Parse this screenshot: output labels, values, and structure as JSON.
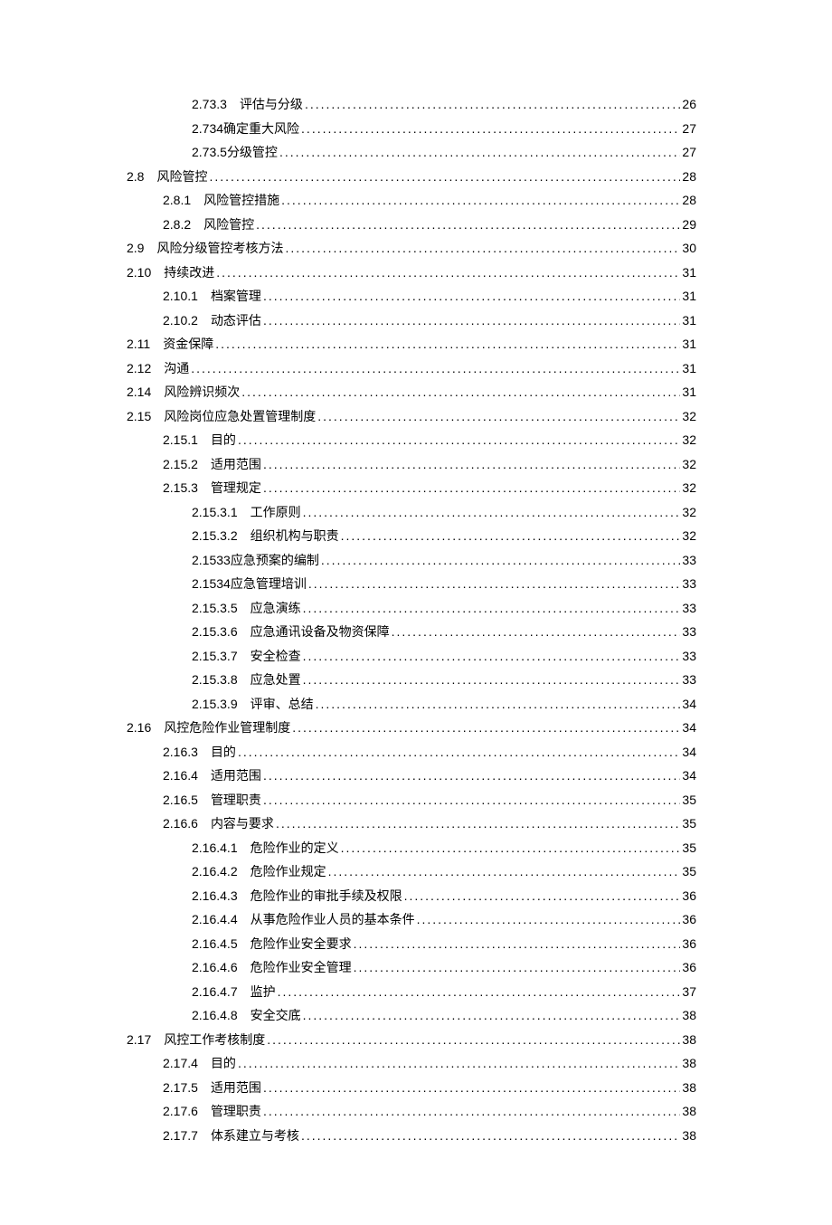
{
  "toc": [
    {
      "indent": 2,
      "num": "2.73.3",
      "title": "评估与分级",
      "page": "26"
    },
    {
      "indent": 2,
      "num": "2.734",
      "title": "确定重大风险",
      "page": "27",
      "nogap": true
    },
    {
      "indent": 2,
      "num": "2.73.5",
      "title": "分级管控",
      "page": "27",
      "nogap": true
    },
    {
      "indent": 0,
      "num": "2.8",
      "title": "风险管控",
      "page": "28"
    },
    {
      "indent": 1,
      "num": "2.8.1",
      "title": "风险管控措施",
      "page": "28"
    },
    {
      "indent": 1,
      "num": "2.8.2",
      "title": "风险管控",
      "page": "29"
    },
    {
      "indent": 0,
      "num": "2.9",
      "title": "风险分级管控考核方法",
      "page": "30"
    },
    {
      "indent": 0,
      "num": "2.10",
      "title": "持续改进",
      "page": "31"
    },
    {
      "indent": 1,
      "num": "2.10.1",
      "title": "档案管理",
      "page": "31"
    },
    {
      "indent": 1,
      "num": "2.10.2",
      "title": "动态评估",
      "page": "31"
    },
    {
      "indent": 0,
      "num": "2.11",
      "title": "资金保障",
      "page": "31"
    },
    {
      "indent": 0,
      "num": "2.12",
      "title": "沟通",
      "page": "31"
    },
    {
      "indent": 0,
      "num": "2.14",
      "title": "风险辨识频次",
      "page": "31"
    },
    {
      "indent": 0,
      "num": "2.15",
      "title": "风险岗位应急处置管理制度",
      "page": "32"
    },
    {
      "indent": 1,
      "num": "2.15.1",
      "title": "目的",
      "page": "32"
    },
    {
      "indent": 1,
      "num": "2.15.2",
      "title": "适用范围",
      "page": "32"
    },
    {
      "indent": 1,
      "num": "2.15.3",
      "title": "管理规定",
      "page": "32"
    },
    {
      "indent": 2,
      "num": "2.15.3.1",
      "title": "工作原则",
      "page": "32"
    },
    {
      "indent": 2,
      "num": "2.15.3.2",
      "title": "组织机构与职责",
      "page": "32"
    },
    {
      "indent": 2,
      "num": "2.1533",
      "title": "应急预案的编制",
      "page": "33",
      "nogap": true
    },
    {
      "indent": 2,
      "num": "2.1534",
      "title": "应急管理培训",
      "page": "33",
      "nogap": true
    },
    {
      "indent": 2,
      "num": "2.15.3.5",
      "title": "应急演练",
      "page": "33"
    },
    {
      "indent": 2,
      "num": "2.15.3.6",
      "title": "应急通讯设备及物资保障",
      "page": "33"
    },
    {
      "indent": 2,
      "num": "2.15.3.7",
      "title": "安全检查",
      "page": "33"
    },
    {
      "indent": 2,
      "num": "2.15.3.8",
      "title": "应急处置",
      "page": "33"
    },
    {
      "indent": 2,
      "num": "2.15.3.9",
      "title": "评审、总结",
      "page": "34"
    },
    {
      "indent": 0,
      "num": "2.16",
      "title": "风控危险作业管理制度",
      "page": "34"
    },
    {
      "indent": 1,
      "num": "2.16.3",
      "title": "目的",
      "page": "34"
    },
    {
      "indent": 1,
      "num": "2.16.4",
      "title": "适用范围",
      "page": "34"
    },
    {
      "indent": 1,
      "num": "2.16.5",
      "title": "管理职责",
      "page": "35"
    },
    {
      "indent": 1,
      "num": "2.16.6",
      "title": "内容与要求",
      "page": "35"
    },
    {
      "indent": 2,
      "num": "2.16.4.1",
      "title": "危险作业的定义",
      "page": "35"
    },
    {
      "indent": 2,
      "num": "2.16.4.2",
      "title": "危险作业规定",
      "page": "35"
    },
    {
      "indent": 2,
      "num": "2.16.4.3",
      "title": "危险作业的审批手续及权限",
      "page": "36"
    },
    {
      "indent": 2,
      "num": "2.16.4.4",
      "title": "从事危险作业人员的基本条件",
      "page": "36"
    },
    {
      "indent": 2,
      "num": "2.16.4.5",
      "title": "危险作业安全要求",
      "page": "36"
    },
    {
      "indent": 2,
      "num": "2.16.4.6",
      "title": "危险作业安全管理",
      "page": "36"
    },
    {
      "indent": 2,
      "num": "2.16.4.7",
      "title": "监护",
      "page": "37"
    },
    {
      "indent": 2,
      "num": "2.16.4.8",
      "title": "安全交底",
      "page": "38"
    },
    {
      "indent": 0,
      "num": "2.17",
      "title": "风控工作考核制度",
      "page": "38"
    },
    {
      "indent": 1,
      "num": "2.17.4",
      "title": "目的",
      "page": "38"
    },
    {
      "indent": 1,
      "num": "2.17.5",
      "title": "适用范围",
      "page": "38"
    },
    {
      "indent": 1,
      "num": "2.17.6",
      "title": "管理职责",
      "page": "38"
    },
    {
      "indent": 1,
      "num": "2.17.7",
      "title": "体系建立与考核",
      "page": "38"
    }
  ]
}
